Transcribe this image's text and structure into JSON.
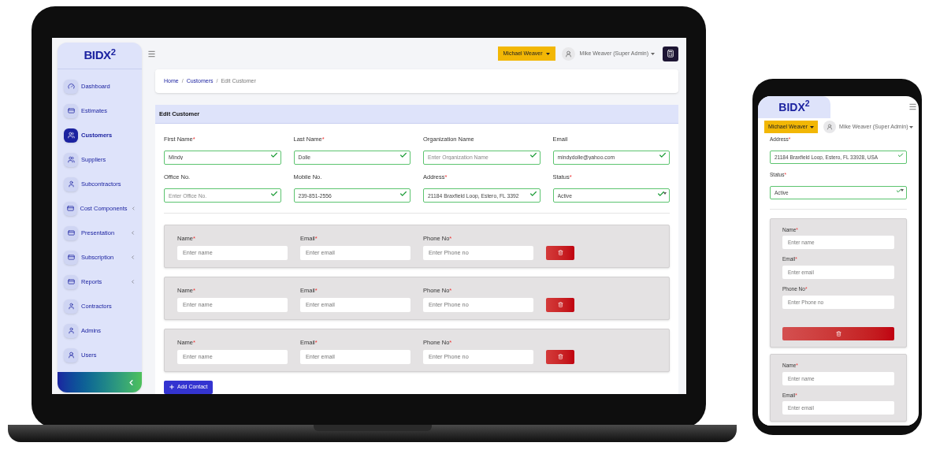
{
  "laptop": {
    "logo": "BIDX$^{2}$",
    "sidebar": [
      {
        "label": "Dashboard",
        "selected": false,
        "expandable": false
      },
      {
        "label": "Estimates",
        "selected": false,
        "expandable": false
      },
      {
        "label": "Customers",
        "selected": true,
        "expandable": false
      },
      {
        "label": "Suppliers",
        "selected": false,
        "expandable": false
      },
      {
        "label": "Subcontractors",
        "selected": false,
        "expandable": false
      },
      {
        "label": "Cost Components",
        "selected": false,
        "expandable": true
      },
      {
        "label": "Presentation",
        "selected": false,
        "expandable": true
      },
      {
        "label": "Subscription",
        "selected": false,
        "expandable": true
      },
      {
        "label": "Reports",
        "selected": false,
        "expandable": true
      },
      {
        "label": "Contractors",
        "selected": false,
        "expandable": false
      },
      {
        "label": "Admins",
        "selected": false,
        "expandable": false
      },
      {
        "label": "Users",
        "selected": false,
        "expandable": false
      }
    ],
    "company_button": "Michael Weaver",
    "user_menu": "Mike Weaver (Super Admin)",
    "breadcrumb_separator": "/",
    "breadcrumb": [
      {
        "label": "Home",
        "current": false
      },
      {
        "label": "Customers",
        "current": false
      },
      {
        "label": "Edit Customer",
        "current": true
      }
    ],
    "card_title": "Edit Customer",
    "fields": [
      {
        "label": "First Name",
        "required_mark": "*",
        "kind": "text",
        "value": "Mindy",
        "valid": true
      },
      {
        "label": "Last Name",
        "required_mark": "*",
        "kind": "text",
        "value": "Dolle",
        "valid": true
      },
      {
        "label": "Organization Name",
        "kind": "text",
        "placeholder": "Enter Organization Name",
        "valid": true
      },
      {
        "label": "Email",
        "kind": "text",
        "value": "mindydolle@yahoo.com",
        "valid": true
      },
      {
        "label": "Office No.",
        "kind": "text",
        "placeholder": "Enter Office No.",
        "valid": true
      },
      {
        "label": "Mobile No.",
        "kind": "text",
        "value": "239-851-2556",
        "valid": true
      },
      {
        "label": "Address",
        "required_mark": "*",
        "kind": "text",
        "value": "21184 Braxfield Loop, Estero, FL 3392",
        "valid": true
      },
      {
        "label": "Status",
        "required_mark": "*",
        "kind": "select",
        "value": "Active",
        "valid": true
      }
    ],
    "contacts": [
      {
        "fields": [
          {
            "label": "Name",
            "required_mark": "*",
            "placeholder": "Enter name"
          },
          {
            "label": "Email",
            "required_mark": "*",
            "placeholder": "Enter email"
          },
          {
            "label": "Phone No",
            "required_mark": "*",
            "placeholder": "Enter Phone no"
          }
        ]
      },
      {
        "fields": [
          {
            "label": "Name",
            "required_mark": "*",
            "placeholder": "Enter name"
          },
          {
            "label": "Email",
            "required_mark": "*",
            "placeholder": "Enter email"
          },
          {
            "label": "Phone No",
            "required_mark": "*",
            "placeholder": "Enter Phone no"
          }
        ]
      },
      {
        "fields": [
          {
            "label": "Name",
            "required_mark": "*",
            "placeholder": "Enter name"
          },
          {
            "label": "Email",
            "required_mark": "*",
            "placeholder": "Enter email"
          },
          {
            "label": "Phone No",
            "required_mark": "*",
            "placeholder": "Enter Phone no"
          }
        ]
      }
    ],
    "add_button": "Add Contact"
  },
  "phone": {
    "logo": "BIDX$^{2}$",
    "company_button": "Michael Weaver",
    "user_menu": "Mike Weaver (Super Admin)",
    "fields": [
      {
        "label": "Address",
        "required_mark": "*",
        "kind": "text",
        "value": "21184 Braxfield Loop, Estero, FL 33928, USA",
        "valid": true
      },
      {
        "label": "Status",
        "required_mark": "*",
        "kind": "select",
        "value": "Active",
        "valid": true
      }
    ],
    "contacts": [
      {
        "fields": [
          {
            "label": "Name",
            "required_mark": "*",
            "placeholder": "Enter name"
          },
          {
            "label": "Email",
            "required_mark": "*",
            "placeholder": "Enter email"
          },
          {
            "label": "Phone No",
            "required_mark": "*",
            "placeholder": "Enter Phone no"
          }
        ],
        "delete_button": true
      },
      {
        "fields": [
          {
            "label": "Name",
            "required_mark": "*",
            "placeholder": "Enter name"
          },
          {
            "label": "Email",
            "required_mark": "*",
            "placeholder": "Enter email"
          }
        ],
        "delete_button": false
      }
    ]
  }
}
